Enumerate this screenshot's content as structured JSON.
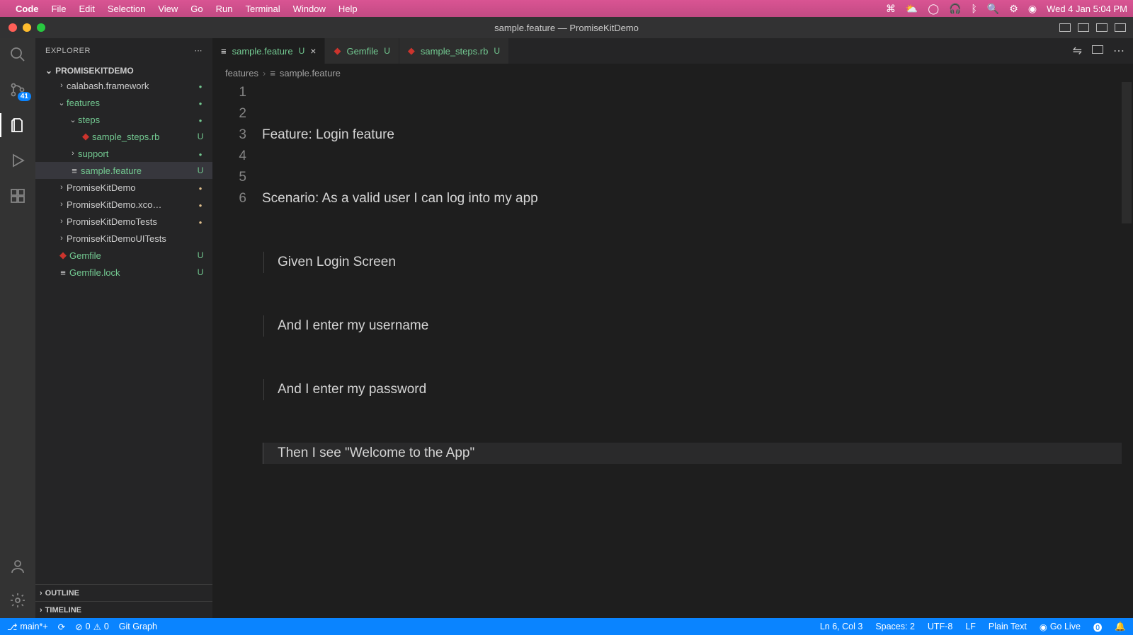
{
  "menubar": {
    "app": "Code",
    "items": [
      "File",
      "Edit",
      "Selection",
      "View",
      "Go",
      "Run",
      "Terminal",
      "Window",
      "Help"
    ],
    "clock": "Wed 4 Jan  5:04 PM"
  },
  "titlebar": {
    "title": "sample.feature — PromiseKitDemo"
  },
  "activity": {
    "badge": "41"
  },
  "sidebar": {
    "header": "EXPLORER",
    "root": "PROMISEKITDEMO",
    "outline": "OUTLINE",
    "timeline": "TIMELINE",
    "tree": {
      "calabash": "calabash.framework",
      "features": "features",
      "steps": "steps",
      "sample_steps": "sample_steps.rb",
      "support": "support",
      "sample_feature": "sample.feature",
      "pkd": "PromiseKitDemo",
      "pkdx": "PromiseKitDemo.xco…",
      "pkdt": "PromiseKitDemoTests",
      "pkdu": "PromiseKitDemoUITests",
      "gemfile": "Gemfile",
      "gemlock": "Gemfile.lock",
      "u": "U"
    }
  },
  "tabs": {
    "t1": "sample.feature",
    "t1s": "U",
    "t2": "Gemfile",
    "t2s": "U",
    "t3": "sample_steps.rb",
    "t3s": "U"
  },
  "breadcrumbs": {
    "a": "features",
    "b": "sample.feature"
  },
  "code": {
    "l1": "Feature: Login feature",
    "l2": "Scenario: As a valid user I can log into my app",
    "l3": "Given Login Screen",
    "l4": "And I enter my username",
    "l5": "And I enter my password",
    "l6": "Then I see \"Welcome to the App\""
  },
  "status": {
    "branch": "main*+",
    "errors": "0",
    "warnings": "0",
    "gitgraph": "Git Graph",
    "lncol": "Ln 6, Col 3",
    "spaces": "Spaces: 2",
    "enc": "UTF-8",
    "eol": "LF",
    "lang": "Plain Text",
    "golive": "Go Live"
  }
}
